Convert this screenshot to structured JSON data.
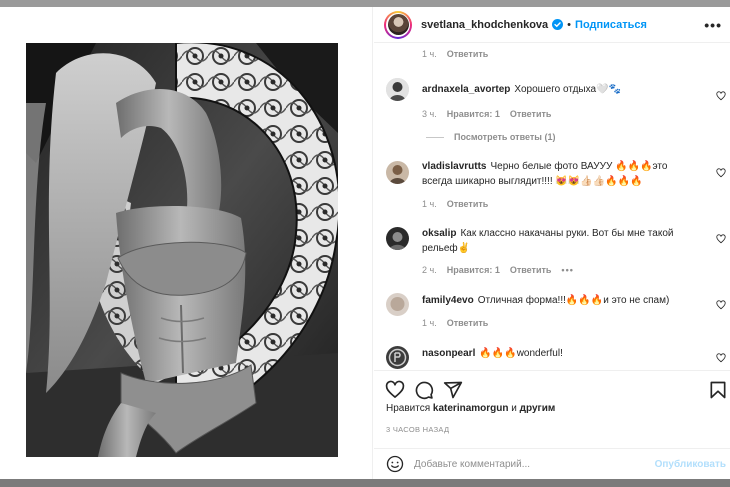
{
  "post": {
    "username": "svetlana_khodchenkova",
    "separator": "•",
    "follow_label": "Подписаться",
    "more_label": "•••"
  },
  "comments": {
    "top_meta": {
      "time": "1 ч.",
      "reply": "Ответить"
    },
    "items": [
      {
        "user": "ardnaxela_avortep",
        "text": "Хорошего отдыха🤍🐾",
        "time": "3 ч.",
        "likes": "Нравится: 1",
        "reply": "Ответить"
      },
      {
        "user": "vladislavrutts",
        "text": "Черно белые фото ВАУУУ 🔥🔥🔥это всегда шикарно выглядит!!!! 😻😻👍🏻👍🏻🔥🔥🔥",
        "time": "1 ч.",
        "reply": "Ответить"
      },
      {
        "user": "oksalip",
        "text": "Как классно накачаны руки. Вот бы мне такой рельеф✌️",
        "time": "2 ч.",
        "likes": "Нравится: 1",
        "reply": "Ответить",
        "more": "•••"
      },
      {
        "user": "family4evo",
        "text": "Отличная форма!!!🔥🔥🔥и это не спам)",
        "time": "1 ч.",
        "reply": "Ответить"
      },
      {
        "user": "nasonpearl",
        "text": "🔥🔥🔥wonderful!"
      }
    ],
    "view_replies": "Посмотреть ответы (1)"
  },
  "actions": {
    "likes_prefix": "Нравится ",
    "likes_user": "katerinamorgun",
    "likes_and": " и ",
    "likes_others": "другим",
    "date": "3 ЧАСОВ НАЗАД"
  },
  "add_comment": {
    "placeholder": "Добавьте комментарий...",
    "publish_label": "Опубликовать"
  },
  "colors": {
    "accent": "#0095f6",
    "publish_disabled": "#b2dffc",
    "muted": "#8e8e8e",
    "text": "#262626"
  },
  "icons": [
    "verified-badge-icon",
    "heart-icon",
    "comment-icon",
    "share-icon",
    "bookmark-icon",
    "emoji-icon",
    "more-options-icon"
  ]
}
